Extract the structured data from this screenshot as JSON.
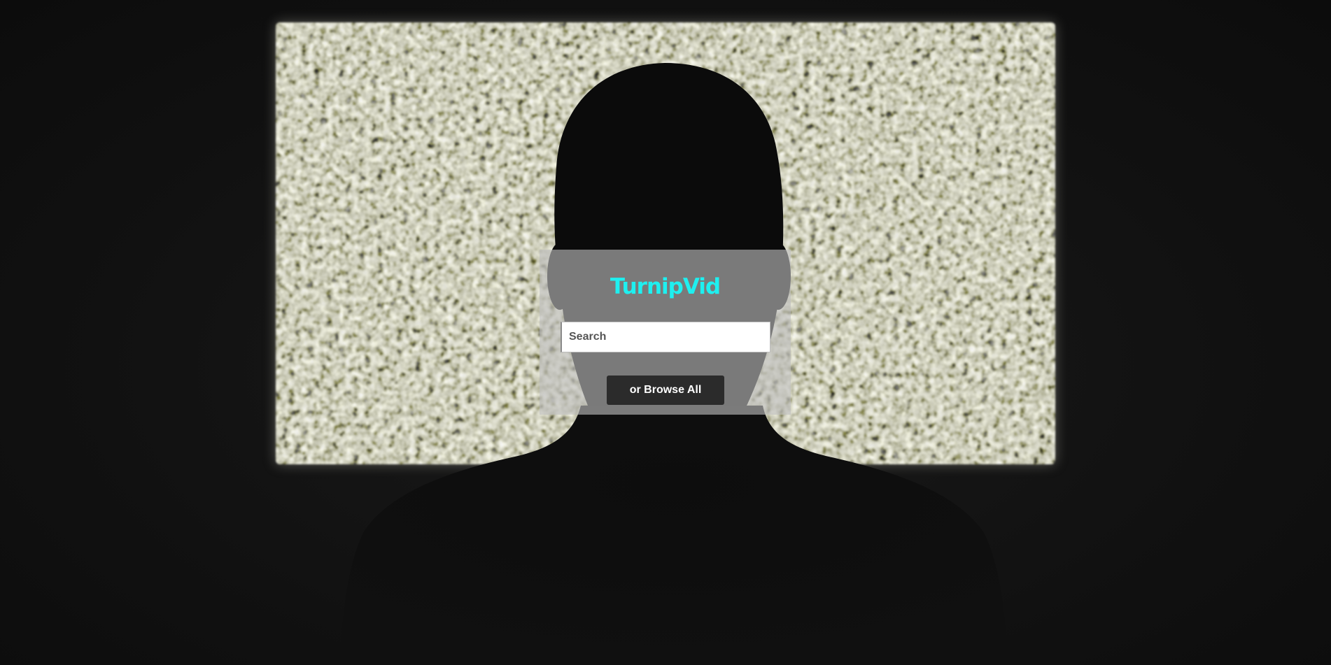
{
  "app": {
    "brand": "TurnipVid",
    "brand_color": "#1ef0f0"
  },
  "search": {
    "placeholder": "Search",
    "value": ""
  },
  "browse": {
    "label": "or Browse All"
  },
  "background": {
    "image": "person silhouette in front of TV static",
    "icon": "tv-static-background"
  },
  "colors": {
    "page_background": "#121212",
    "button_background": "#2b2b2b",
    "panel_overlay": "rgba(190,190,190,0.62)"
  }
}
